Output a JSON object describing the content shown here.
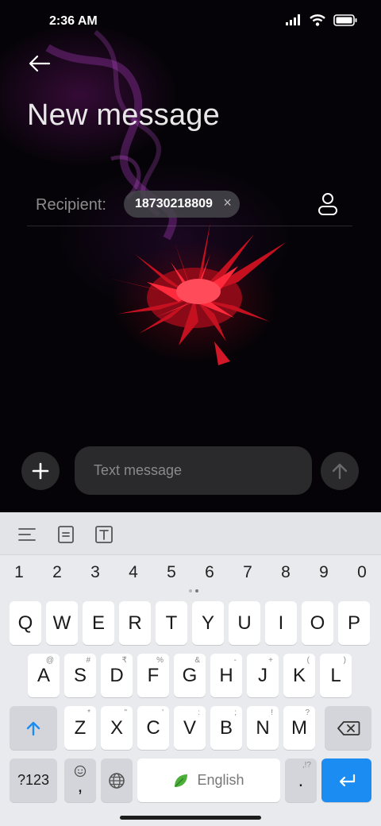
{
  "status_bar": {
    "time": "2:36 AM",
    "icons": [
      "signal-icon",
      "wifi-icon",
      "battery-icon"
    ]
  },
  "header": {
    "back_icon": "back-arrow-icon",
    "title": "New message"
  },
  "recipient": {
    "label": "Recipient:",
    "chip": "18730218809",
    "chip_remove": "×",
    "contact_icon": "contact-icon"
  },
  "composer": {
    "add_icon": "plus-icon",
    "placeholder": "Text message",
    "send_icon": "send-arrow-icon"
  },
  "keyboard": {
    "toolbar_icons": [
      "menu-lines-icon",
      "clipboard-icon",
      "text-format-icon"
    ],
    "numbers": [
      "1",
      "2",
      "3",
      "4",
      "5",
      "6",
      "7",
      "8",
      "9",
      "0"
    ],
    "row1": [
      "Q",
      "W",
      "E",
      "R",
      "T",
      "Y",
      "U",
      "I",
      "O",
      "P"
    ],
    "row2": [
      {
        "k": "A",
        "h": "@"
      },
      {
        "k": "S",
        "h": "#"
      },
      {
        "k": "D",
        "h": "₹"
      },
      {
        "k": "F",
        "h": "%"
      },
      {
        "k": "G",
        "h": "&"
      },
      {
        "k": "H",
        "h": "-"
      },
      {
        "k": "J",
        "h": "+"
      },
      {
        "k": "K",
        "h": "("
      },
      {
        "k": "L",
        "h": ")"
      }
    ],
    "row3": [
      {
        "k": "Z",
        "h": "*"
      },
      {
        "k": "X",
        "h": "\""
      },
      {
        "k": "C",
        "h": "'"
      },
      {
        "k": "V",
        "h": ":"
      },
      {
        "k": "B",
        "h": ";"
      },
      {
        "k": "N",
        "h": "!"
      },
      {
        "k": "M",
        "h": "?"
      }
    ],
    "symbols_label": "?123",
    "comma_label": ",",
    "space_label": "English",
    "period_label": ".",
    "period_hint": ",!?",
    "colors": {
      "accent": "#1a8cf2",
      "key": "#ffffff",
      "key_gray": "#d4d5da"
    }
  }
}
